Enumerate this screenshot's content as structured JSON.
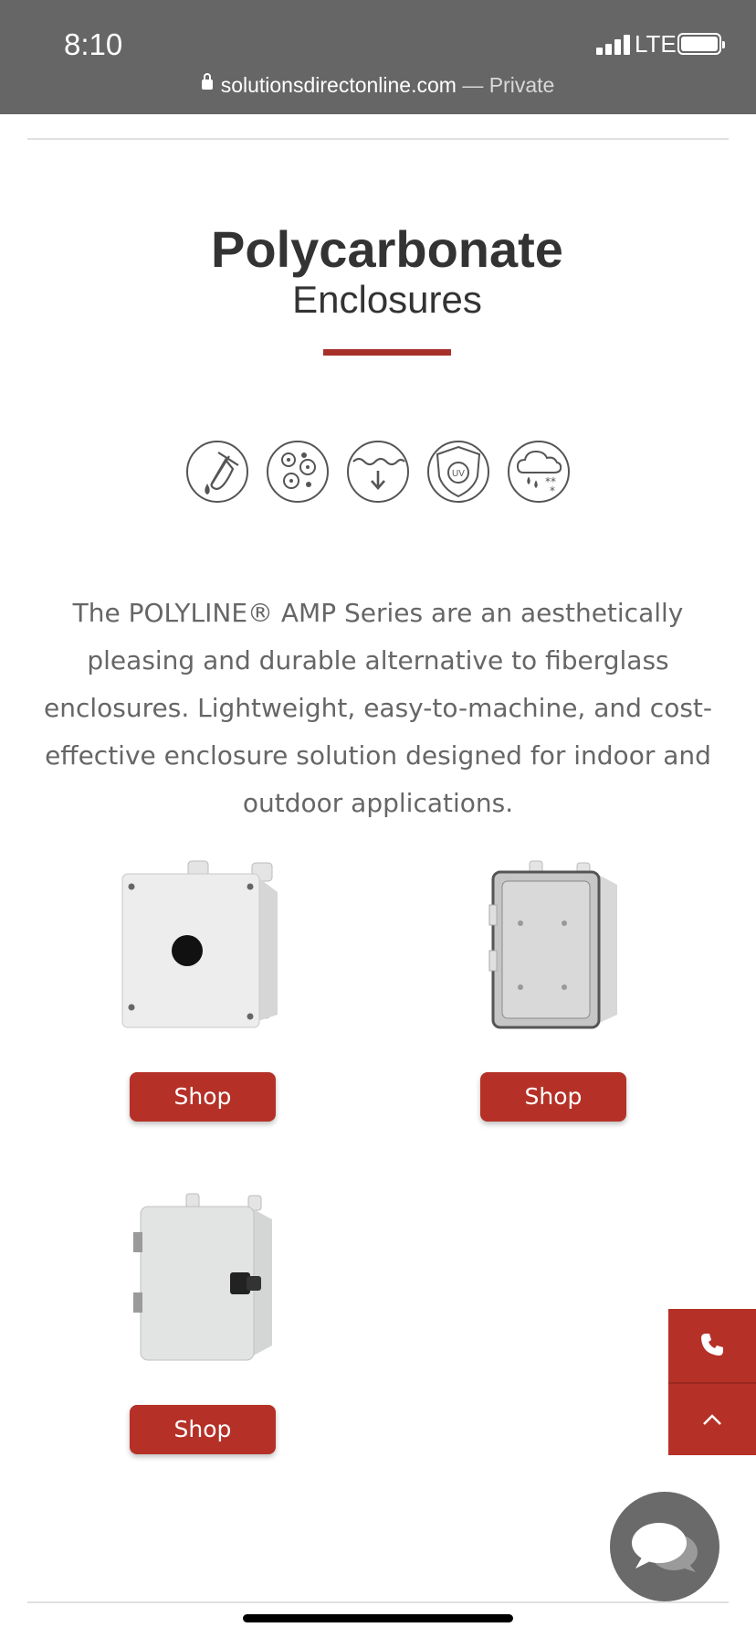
{
  "status_bar": {
    "time": "8:10",
    "network": "LTE",
    "url_host": "solutionsdirectonline.com",
    "url_suffix": " — Private"
  },
  "heading": {
    "title": "Polycarbonate",
    "subtitle": "Enclosures",
    "accent_color": "#a8302b"
  },
  "feature_icons": [
    {
      "name": "chemical-resistance-icon"
    },
    {
      "name": "corrosion-resistance-icon"
    },
    {
      "name": "watertight-icon"
    },
    {
      "name": "uv-protection-icon"
    },
    {
      "name": "weather-resistance-icon"
    }
  ],
  "description": "The POLYLINE® AMP Series are an aesthetically pleasing and durable alternative to fiberglass enclosures. Lightweight, easy-to-machine, and cost-effective enclosure solution designed for indoor and outdoor applications.",
  "products": [
    {
      "image": "pushbutton-enclosure-image",
      "button_label": "Shop"
    },
    {
      "image": "clear-cover-enclosure-image",
      "button_label": "Shop"
    },
    {
      "image": "latched-enclosure-image",
      "button_label": "Shop"
    }
  ],
  "floating_actions": {
    "phone_icon": "phone-icon",
    "top_icon": "chevron-up-icon",
    "chat_icon": "chat-icon",
    "brand_color": "#b53128"
  }
}
